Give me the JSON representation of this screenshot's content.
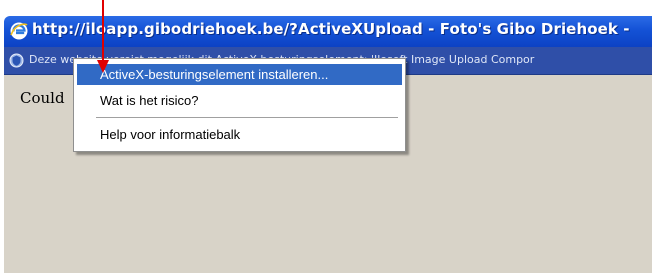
{
  "window": {
    "title": "http://iloapp.gibodriehoek.be/?ActiveXUpload - Foto's Gibo Driehoek -",
    "icon": "internet-explorer-icon"
  },
  "infobar": {
    "text": "Deze website vereist mogelijk dit ActiveX-besturingselement: 'Ilosoft Image Upload Compor",
    "icon": "shield-info-icon"
  },
  "content": {
    "text": "Could"
  },
  "menu": {
    "items": [
      {
        "label": "ActiveX-besturingselement installeren...",
        "selected": true
      },
      {
        "label": "Wat is het risico?",
        "selected": false
      },
      {
        "label": "Help voor informatiebalk",
        "selected": false
      }
    ]
  },
  "colors": {
    "titlebar": "#1452d6",
    "infobar": "#2f4fa8",
    "content_bg": "#d8d3c8",
    "menu_highlight": "#316ac5",
    "annotation_arrow": "#e00000"
  }
}
